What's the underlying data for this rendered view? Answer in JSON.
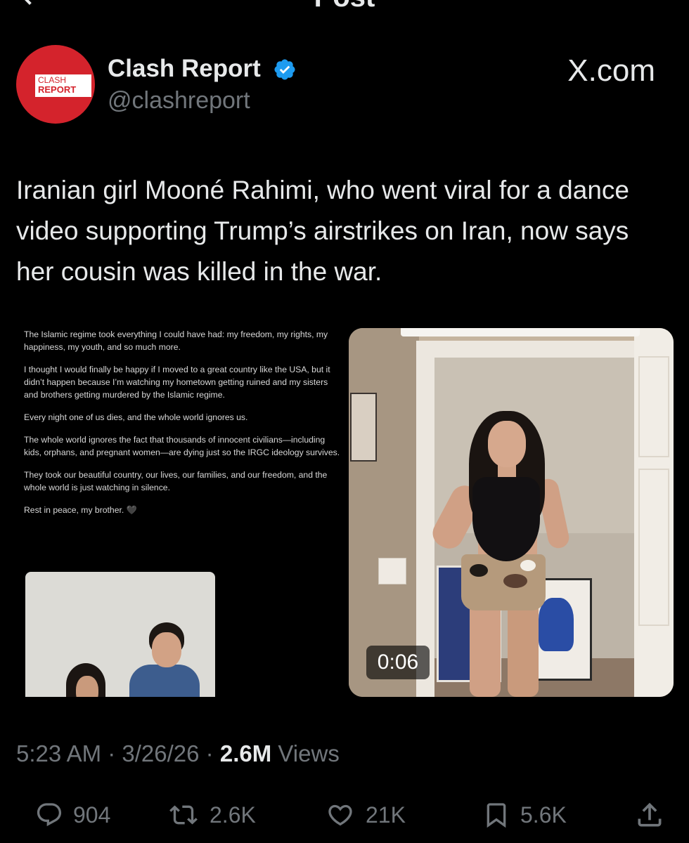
{
  "header": {
    "title": "Post",
    "back_icon": "back-arrow-icon"
  },
  "author": {
    "avatar_line1": "CLASH",
    "avatar_line2": "REPORT",
    "name": "Clash Report",
    "handle": "@clashreport",
    "verified_icon": "verified-badge-icon",
    "verified_color": "#1d9bf0"
  },
  "watermark": "X.com",
  "post": {
    "text": "Iranian girl Mooné Rahimi, who went viral for a dance video supporting Trump’s airstrikes on Iran, now says her cousin was killed in the war."
  },
  "media_left": {
    "paragraphs": [
      "The Islamic regime took everything I could have had: my freedom, my rights, my happiness, my youth, and so much more.",
      "I thought I would finally be happy if I moved to a great country like the USA, but it didn’t happen because I’m watching my hometown getting ruined and my sisters and brothers getting murdered by the Islamic regime.",
      "Every night one of us dies, and the whole world ignores us.",
      "The whole world ignores the fact that thousands of innocent civilians—including kids, orphans, and pregnant women—are dying just so the IRGC ideology survives.",
      "They took our beautiful country, our lives, our families, and our freedom, and the whole world is just watching in silence.",
      "Rest in peace, my brother. 🖤"
    ]
  },
  "media_right": {
    "duration": "0:06"
  },
  "meta": {
    "time": "5:23 AM",
    "sep1": " · ",
    "date": "3/26/26",
    "sep2": " · ",
    "views_count": "2.6M",
    "views_label": " Views"
  },
  "actions": {
    "replies": "904",
    "reposts": "2.6K",
    "likes": "21K",
    "bookmarks": "5.6K",
    "icons": [
      "reply-icon",
      "repost-icon",
      "like-icon",
      "bookmark-icon",
      "share-icon"
    ]
  }
}
